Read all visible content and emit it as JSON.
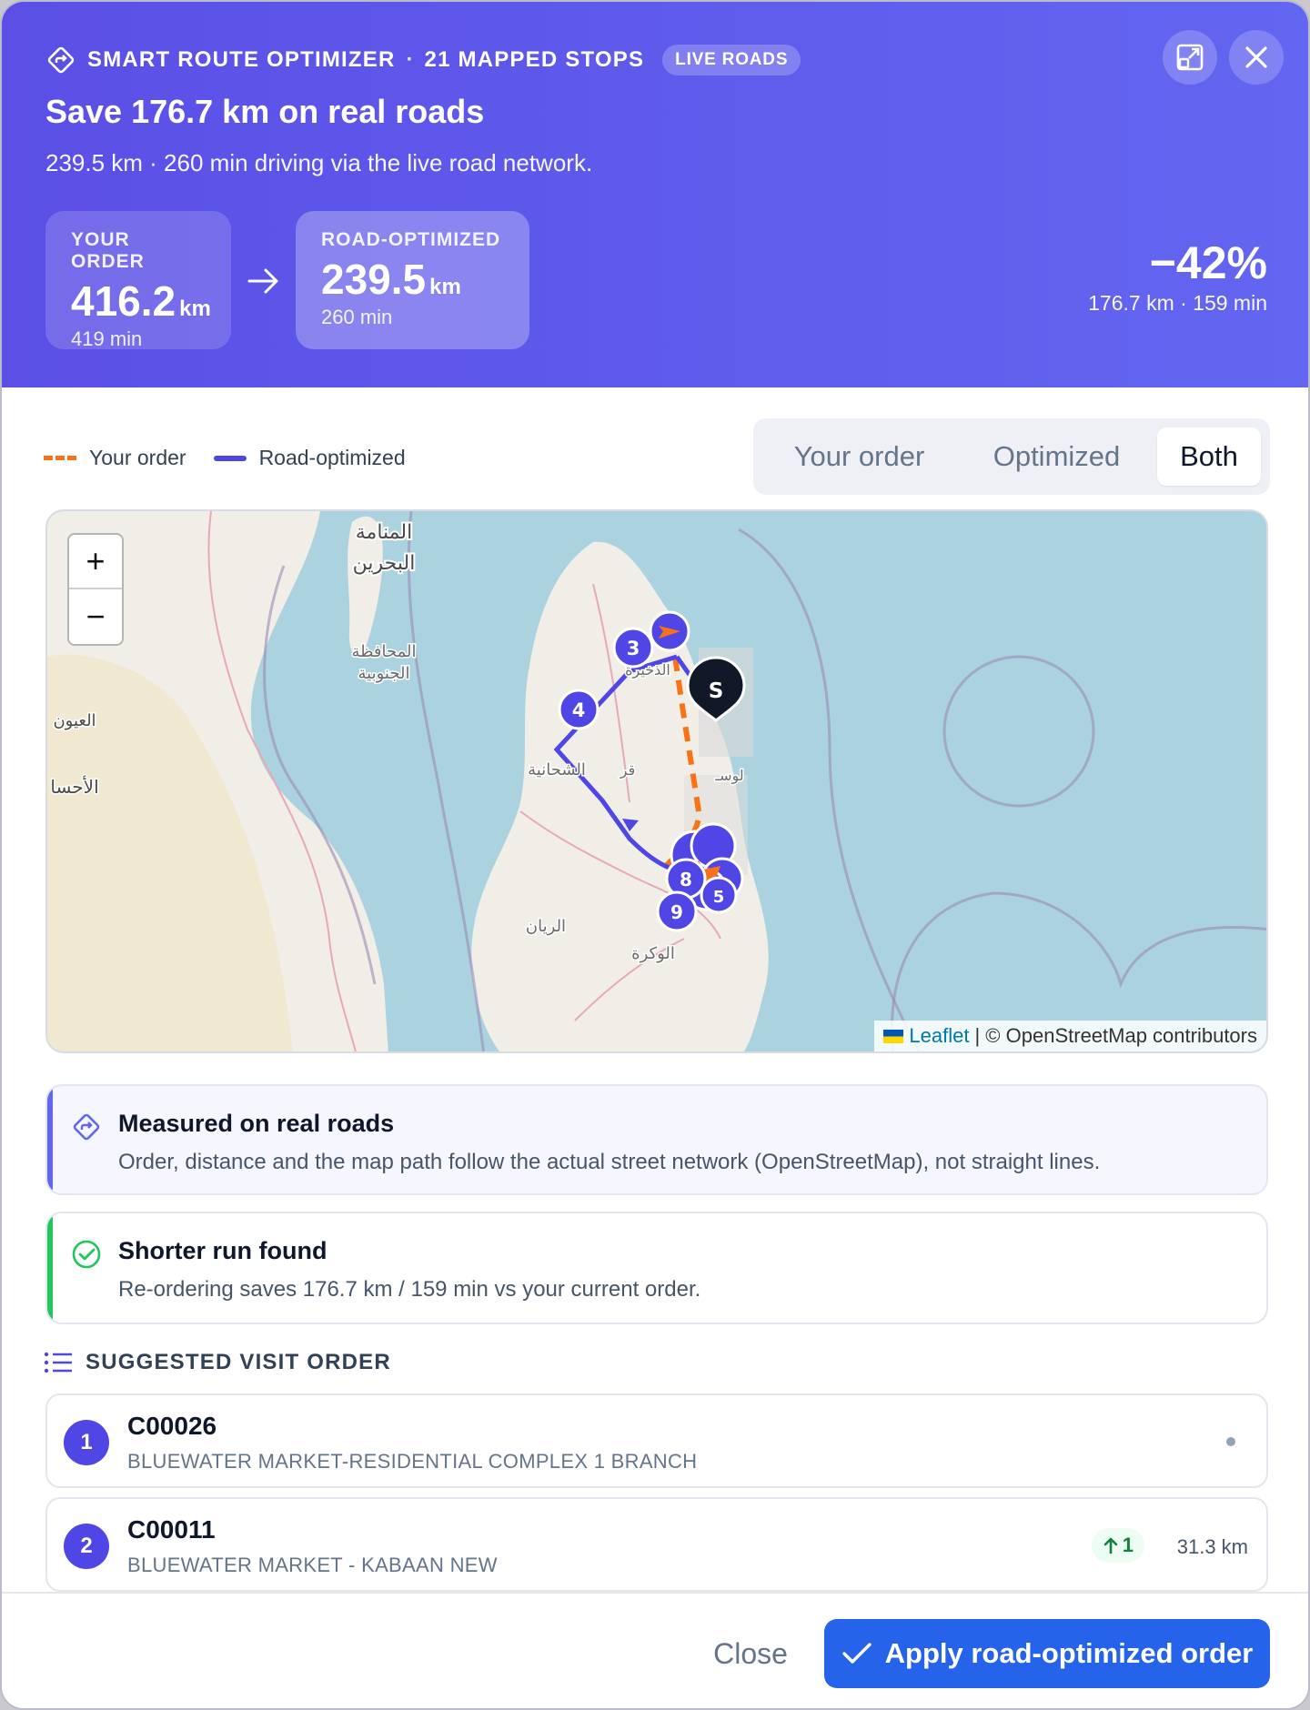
{
  "header": {
    "brand": "SMART ROUTE OPTIMIZER",
    "stops": "21 MAPPED STOPS",
    "badge": "LIVE ROADS",
    "headline": "Save 176.7 km on real roads",
    "subline": "239.5 km · 260 min driving via the live road network.",
    "your_order": {
      "label": "YOUR ORDER",
      "value": "416.2",
      "unit": "km",
      "time": "419 min"
    },
    "optimized": {
      "label": "ROAD-OPTIMIZED",
      "value": "239.5",
      "unit": "km",
      "time": "260 min"
    },
    "savings_pct": "−42%",
    "savings_detail": "176.7 km · 159 min"
  },
  "legend": {
    "yours": "Your order",
    "optimized": "Road-optimized"
  },
  "toggle": {
    "options": [
      "Your order",
      "Optimized",
      "Both"
    ],
    "selected": "Both"
  },
  "map": {
    "labels": {
      "manama": "المنامة",
      "bahrain": "البحرين",
      "southern1": "المحافظة",
      "southern2": "الجنوبية",
      "uyun": "العيون",
      "ahsa": "الأحسا",
      "shahaniya": "الشحانية",
      "rayyan": "الريان",
      "wakra": "الوكرة",
      "dhakhira": "الذخيرة",
      "qa": "قر",
      "lus": "لوسـ"
    },
    "markers": {
      "stop3": "3",
      "stop4": "4",
      "stop8": "8",
      "stop9": "9",
      "stop5": "5",
      "start": "S"
    },
    "zoom_in": "+",
    "zoom_out": "−",
    "attribution_leaflet": "Leaflet",
    "attribution_rest": "| © OpenStreetMap contributors"
  },
  "cards": {
    "measured": {
      "title": "Measured on real roads",
      "desc": "Order, distance and the map path follow the actual street network (OpenStreetMap), not straight lines."
    },
    "shorter": {
      "title": "Shorter run found",
      "desc": "Re-ordering saves 176.7 km / 159 min vs your current order."
    }
  },
  "visit": {
    "title": "SUGGESTED VISIT ORDER",
    "rows": [
      {
        "num": "1",
        "code": "C00026",
        "name": "BLUEWATER MARKET-RESIDENTIAL COMPLEX 1 BRANCH"
      },
      {
        "num": "2",
        "code": "C00011",
        "name": "BLUEWATER MARKET - KABAAN NEW",
        "delta": "1",
        "dist": "31.3 km"
      }
    ]
  },
  "footer": {
    "close": "Close",
    "apply": "Apply road-optimized order"
  },
  "colors": {
    "accent": "#6366f1",
    "primary": "#2563eb",
    "route_yours": "#f97316",
    "route_opt": "#4f46e5",
    "success": "#22c55e"
  }
}
